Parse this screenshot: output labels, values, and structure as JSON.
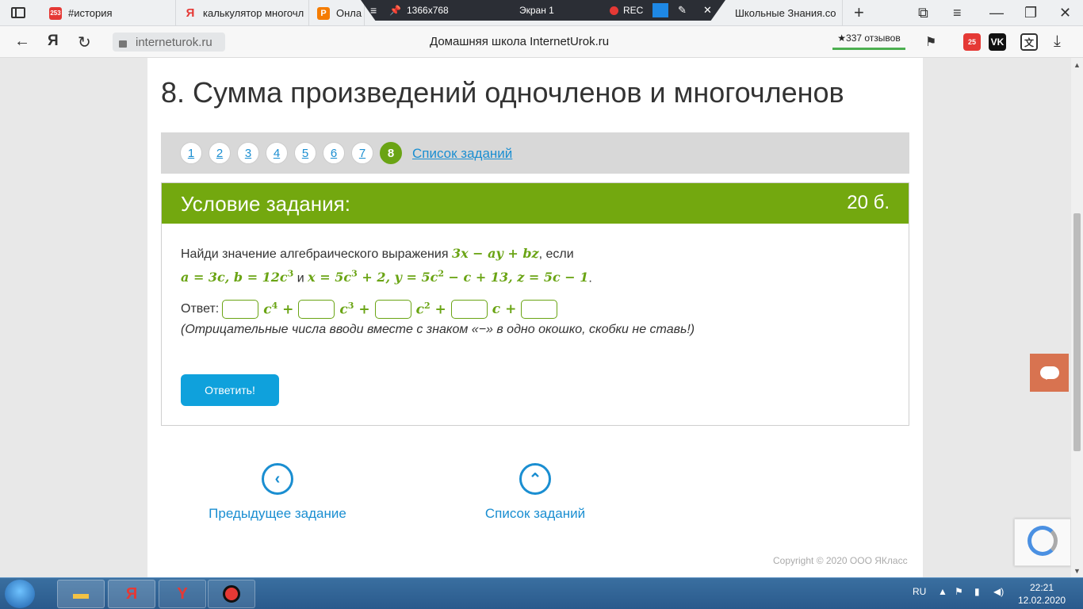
{
  "browser": {
    "tabs": [
      {
        "label": "#история",
        "badge": "253"
      },
      {
        "label": "калькулятор многочл",
        "badge": "Я"
      },
      {
        "label": "Онла",
        "badge": "Р"
      },
      {
        "label": "Школьные Знания.co",
        "badge": ""
      }
    ],
    "recorder": {
      "resolution": "1366x768",
      "screen": "Экран 1",
      "rec": "REC"
    },
    "url": "interneturok.ru",
    "page_title": "Домашняя школа InternetUrok.ru",
    "reviews": "★337 отзывов",
    "ext_badge": "25"
  },
  "lesson": {
    "title": "8. Сумма произведений одночленов и многочленов",
    "pages": [
      "1",
      "2",
      "3",
      "4",
      "5",
      "6",
      "7",
      "8"
    ],
    "active_page": "8",
    "task_list_link": "Список заданий"
  },
  "task": {
    "header": "Условие задания:",
    "points": "20 б.",
    "intro": "Найди значение алгебраического выражения ",
    "expr": "3x − ay + bz",
    "if_word": ", если",
    "cond_a": "a = 3c, b = 12c",
    "and_word": " и ",
    "cond_x": "x = 5c",
    "cond_x_tail": " + 2, y = 5c",
    "cond_y_tail": " − c + 13,  z = 5c − 1",
    "period": ".",
    "answer_label": "Ответ: ",
    "hint": "(Отрицательные числа вводи вместе с знаком «−» в одно окошко, скобки не ставь!)",
    "submit": "Ответить!"
  },
  "nav": {
    "prev": "Предыдущее задание",
    "list": "Список заданий"
  },
  "footer": {
    "copyright": "Copyright © 2020 ООО ЯКласс"
  },
  "taskbar": {
    "lang": "RU",
    "time": "22:21",
    "date": "12.02.2020"
  },
  "colors": {
    "accent_green": "#73a80f",
    "link_blue": "#1a8ed1",
    "button_blue": "#0fa1dc",
    "chat_orange": "#d87350"
  }
}
